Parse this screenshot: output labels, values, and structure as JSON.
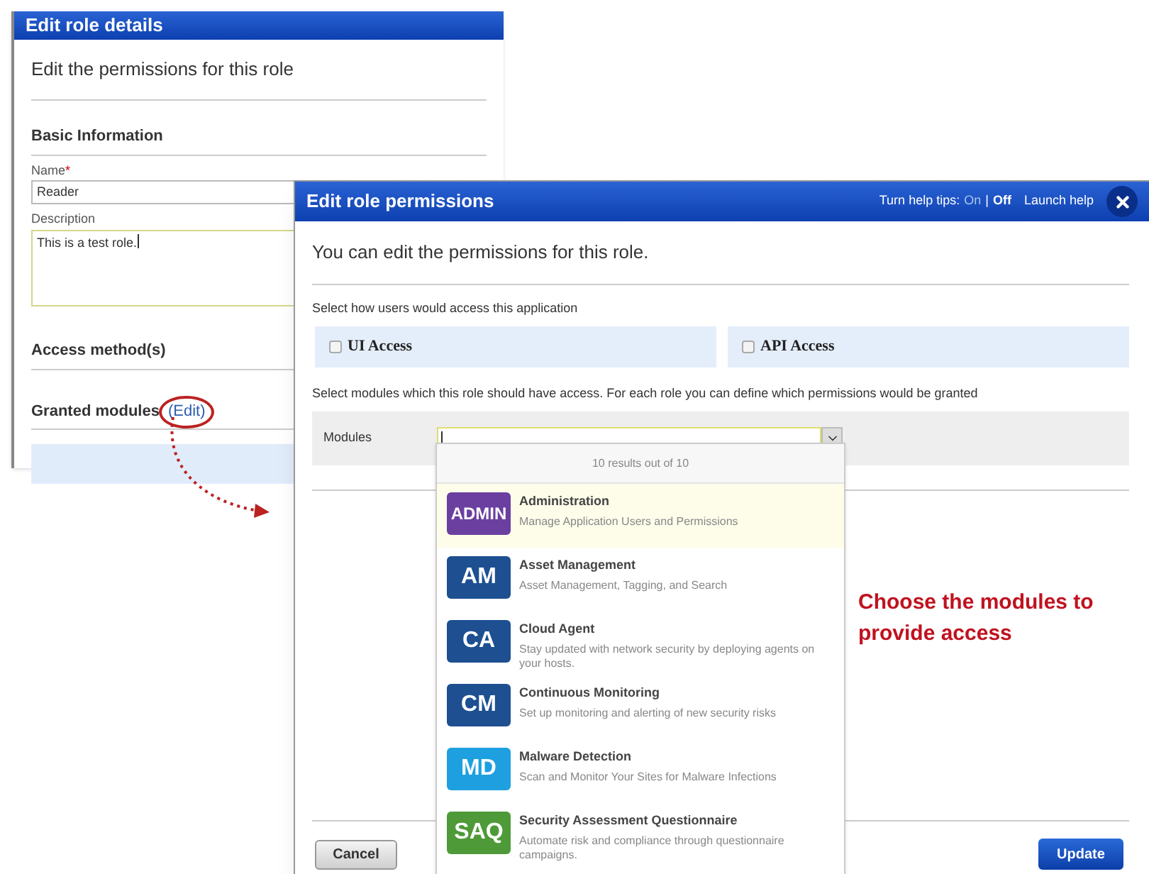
{
  "role_details": {
    "title": "Edit role details",
    "subtitle": "Edit the permissions for this role",
    "basic_heading": "Basic Information",
    "name_label": "Name",
    "required_mark": "*",
    "name_value": "Reader",
    "description_label": "Description",
    "description_value": "This is a test role.",
    "access_heading": "Access method(s)",
    "modules_heading": "Granted modules",
    "edit_link": "(Edit)"
  },
  "permissions_dialog": {
    "title": "Edit role permissions",
    "help_tips_label": "Turn help tips:",
    "help_tips_options": [
      {
        "label": "On",
        "selected": false
      },
      {
        "label": "Off",
        "selected": true
      }
    ],
    "help_separator": "|",
    "launch_help": "Launch help",
    "intro": "You can edit the permissions for this role.",
    "access_prompt": "Select how users would access this application",
    "access_options": [
      {
        "label": "UI Access",
        "checked": false
      },
      {
        "label": "API Access",
        "checked": false
      }
    ],
    "modules_prompt": "Select modules which this role should have access. For each role you can define which permissions would be granted",
    "modules_label": "Modules",
    "results_count": "10 results out of 10",
    "modules": [
      {
        "badge": "ADMIN",
        "name": "Administration",
        "description": "Manage Application Users and Permissions",
        "color": "#6b3fa0",
        "selected": true
      },
      {
        "badge": "AM",
        "name": "Asset Management",
        "description": "Asset Management, Tagging, and Search",
        "color": "#1d4f91",
        "selected": false
      },
      {
        "badge": "CA",
        "name": "Cloud Agent",
        "description": "Stay updated with network security by deploying agents on your hosts.",
        "color": "#1d4f91",
        "selected": false
      },
      {
        "badge": "CM",
        "name": "Continuous Monitoring",
        "description": "Set up monitoring and alerting of new security risks",
        "color": "#1d4f91",
        "selected": false
      },
      {
        "badge": "MD",
        "name": "Malware Detection",
        "description": "Scan and Monitor Your Sites for Malware Infections",
        "color": "#1ea0e0",
        "selected": false
      },
      {
        "badge": "SAQ",
        "name": "Security Assessment Questionnaire",
        "description": "Automate risk and compliance through questionnaire campaigns.",
        "color": "#4e9a38",
        "selected": false
      }
    ],
    "cancel": "Cancel",
    "update": "Update"
  },
  "annotation": "Choose the modules to provide access"
}
